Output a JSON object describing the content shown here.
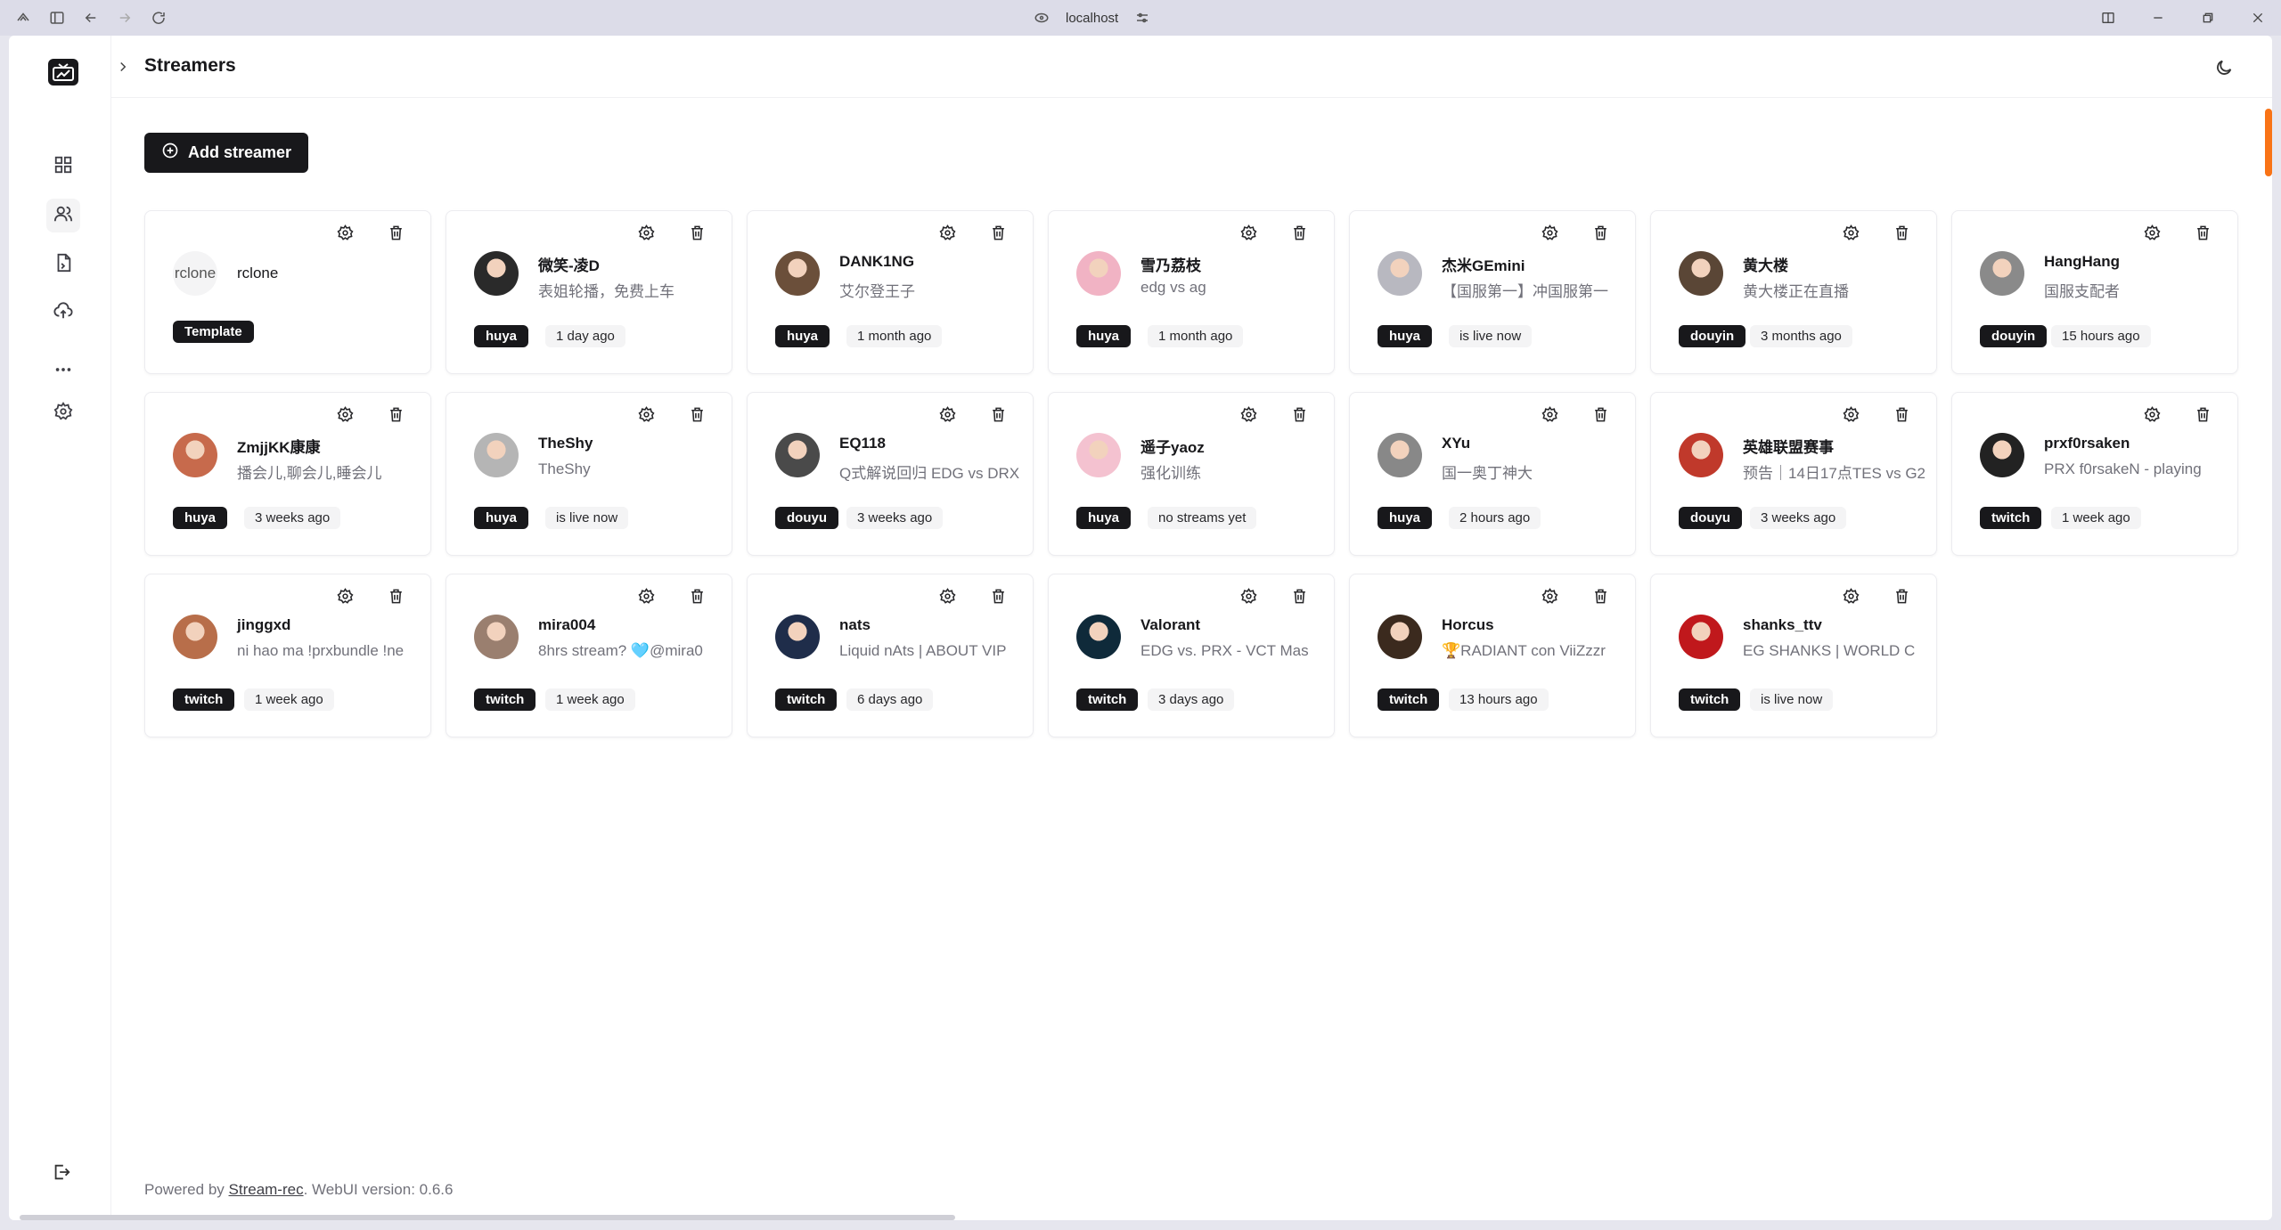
{
  "browser": {
    "address": "localhost"
  },
  "page": {
    "title": "Streamers"
  },
  "toolbar": {
    "add_label": "Add streamer"
  },
  "nav": [
    "dashboard-icon",
    "users-icon",
    "files-icon",
    "upload-icon",
    "more-icon",
    "settings-icon"
  ],
  "template_card": {
    "avatar_text": "rclone",
    "name": "rclone",
    "badge": "Template"
  },
  "streamers": [
    {
      "name": "微笑-凌D",
      "desc": "表姐轮播，免费上车",
      "platform": "huya",
      "status": "1 day ago",
      "color": "#2a2a2a"
    },
    {
      "name": "DANK1NG",
      "desc": "艾尔登王子",
      "platform": "huya",
      "status": "1 month ago",
      "color": "#6b4f3a"
    },
    {
      "name": "雪乃荔枝",
      "desc": "edg vs ag",
      "platform": "huya",
      "status": "1 month ago",
      "color": "#f1b3c4"
    },
    {
      "name": "杰米GEmini",
      "desc": "【国服第一】冲国服第一",
      "platform": "huya",
      "status": "is live now",
      "color": "#b8b8c0"
    },
    {
      "name": "黄大楼",
      "desc": "黄大楼正在直播",
      "platform": "douyin",
      "status": "3 months ago",
      "color": "#5a4636"
    },
    {
      "name": "HangHang",
      "desc": "国服支配者",
      "platform": "douyin",
      "status": "15 hours ago",
      "color": "#8a8a8a"
    },
    {
      "name": "ZmjjKK康康",
      "desc": "播会儿,聊会儿,睡会儿",
      "platform": "huya",
      "status": "3 weeks ago",
      "color": "#c76a4c"
    },
    {
      "name": "TheShy",
      "desc": "TheShy",
      "platform": "huya",
      "status": "is live now",
      "color": "#b5b5b5"
    },
    {
      "name": "EQ118",
      "desc": "Q式解说回归 EDG vs DRX",
      "platform": "douyu",
      "status": "3 weeks ago",
      "color": "#4a4a4a"
    },
    {
      "name": "遥子yaoz",
      "desc": "强化训练",
      "platform": "huya",
      "status": "no streams yet",
      "color": "#f4c2d0"
    },
    {
      "name": "XYu",
      "desc": "国一奥丁神大",
      "platform": "huya",
      "status": "2 hours ago",
      "color": "#888888"
    },
    {
      "name": "英雄联盟赛事",
      "desc": "预告｜14日17点TES vs G2",
      "platform": "douyu",
      "status": "3 weeks ago",
      "color": "#c0392b"
    },
    {
      "name": "prxf0rsaken",
      "desc": "PRX f0rsakeN - playing",
      "platform": "twitch",
      "status": "1 week ago",
      "color": "#222222"
    },
    {
      "name": "jinggxd",
      "desc": "ni hao ma !prxbundle !ne",
      "platform": "twitch",
      "status": "1 week ago",
      "color": "#b86e4a"
    },
    {
      "name": "mira004",
      "desc": "8hrs stream? 🩵@mira0",
      "platform": "twitch",
      "status": "1 week ago",
      "color": "#9a7f6f"
    },
    {
      "name": "nats",
      "desc": "Liquid nAts | ABOUT VIP",
      "platform": "twitch",
      "status": "6 days ago",
      "color": "#1f2d4a"
    },
    {
      "name": "Valorant",
      "desc": "EDG vs. PRX - VCT Mas",
      "platform": "twitch",
      "status": "3 days ago",
      "color": "#0f2a3a"
    },
    {
      "name": "Horcus",
      "desc": "🏆RADIANT con ViiZzzr",
      "platform": "twitch",
      "status": "13 hours ago",
      "color": "#3b2a1e"
    },
    {
      "name": "shanks_ttv",
      "desc": "EG SHANKS | WORLD C",
      "platform": "twitch",
      "status": "is live now",
      "color": "#c0181c"
    }
  ],
  "footer": {
    "prefix": "Powered by",
    "link": "Stream-rec",
    "version": ". WebUI version: 0.6.6"
  }
}
